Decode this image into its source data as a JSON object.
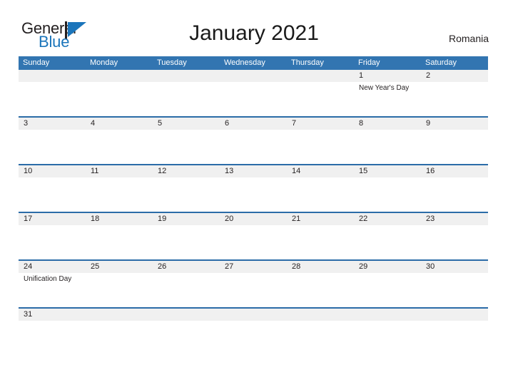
{
  "brand": {
    "word_one": "General",
    "word_two": "Blue",
    "flag_icon": "blue-triangle-flag-icon",
    "color_dark": "#231f20",
    "color_blue": "#1b75bb"
  },
  "header": {
    "title": "January 2021",
    "country": "Romania"
  },
  "theme": {
    "header_blue": "#3275b1",
    "divider_blue": "#2b6ca8",
    "number_band_gray": "#f0f0f0",
    "text_dark": "#231f20",
    "page_background": "#ffffff"
  },
  "calendar": {
    "month": "January",
    "year": "2021",
    "weekday_headers": [
      "Sunday",
      "Monday",
      "Tuesday",
      "Wednesday",
      "Thursday",
      "Friday",
      "Saturday"
    ],
    "weeks": [
      {
        "days": [
          {
            "number": "",
            "event": ""
          },
          {
            "number": "",
            "event": ""
          },
          {
            "number": "",
            "event": ""
          },
          {
            "number": "",
            "event": ""
          },
          {
            "number": "",
            "event": ""
          },
          {
            "number": "1",
            "event": "New Year's Day"
          },
          {
            "number": "2",
            "event": ""
          }
        ]
      },
      {
        "days": [
          {
            "number": "3",
            "event": ""
          },
          {
            "number": "4",
            "event": ""
          },
          {
            "number": "5",
            "event": ""
          },
          {
            "number": "6",
            "event": ""
          },
          {
            "number": "7",
            "event": ""
          },
          {
            "number": "8",
            "event": ""
          },
          {
            "number": "9",
            "event": ""
          }
        ]
      },
      {
        "days": [
          {
            "number": "10",
            "event": ""
          },
          {
            "number": "11",
            "event": ""
          },
          {
            "number": "12",
            "event": ""
          },
          {
            "number": "13",
            "event": ""
          },
          {
            "number": "14",
            "event": ""
          },
          {
            "number": "15",
            "event": ""
          },
          {
            "number": "16",
            "event": ""
          }
        ]
      },
      {
        "days": [
          {
            "number": "17",
            "event": ""
          },
          {
            "number": "18",
            "event": ""
          },
          {
            "number": "19",
            "event": ""
          },
          {
            "number": "20",
            "event": ""
          },
          {
            "number": "21",
            "event": ""
          },
          {
            "number": "22",
            "event": ""
          },
          {
            "number": "23",
            "event": ""
          }
        ]
      },
      {
        "days": [
          {
            "number": "24",
            "event": "Unification Day"
          },
          {
            "number": "25",
            "event": ""
          },
          {
            "number": "26",
            "event": ""
          },
          {
            "number": "27",
            "event": ""
          },
          {
            "number": "28",
            "event": ""
          },
          {
            "number": "29",
            "event": ""
          },
          {
            "number": "30",
            "event": ""
          }
        ]
      },
      {
        "days": [
          {
            "number": "31",
            "event": ""
          },
          {
            "number": "",
            "event": ""
          },
          {
            "number": "",
            "event": ""
          },
          {
            "number": "",
            "event": ""
          },
          {
            "number": "",
            "event": ""
          },
          {
            "number": "",
            "event": ""
          },
          {
            "number": "",
            "event": ""
          }
        ]
      }
    ]
  }
}
